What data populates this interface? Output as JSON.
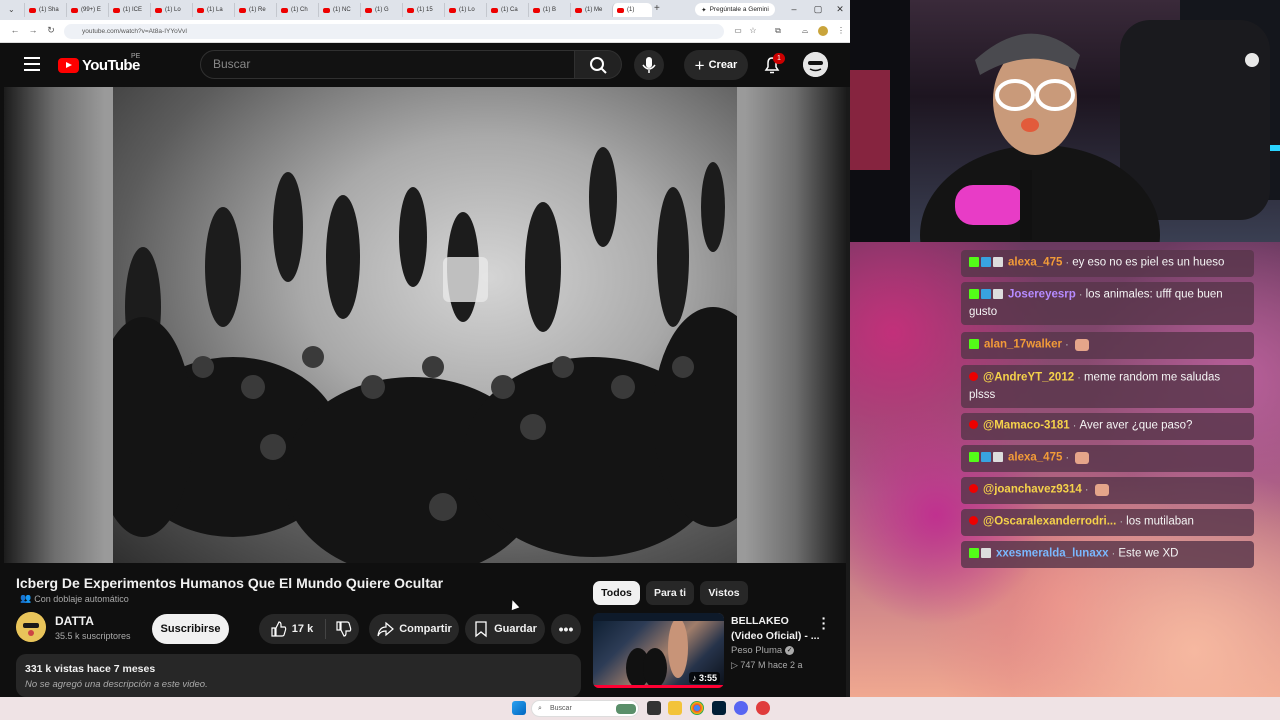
{
  "browser": {
    "tabs": [
      {
        "label": "(1) Sha"
      },
      {
        "label": "(99+) E"
      },
      {
        "label": "(1) ICE"
      },
      {
        "label": "(1) Lo"
      },
      {
        "label": "(1) La"
      },
      {
        "label": "(1) Re"
      },
      {
        "label": "(1) Ch"
      },
      {
        "label": "(1) NC"
      },
      {
        "label": "(1) G"
      },
      {
        "label": "(1) 15"
      },
      {
        "label": "(1) Lo"
      },
      {
        "label": "(1) Ca"
      },
      {
        "label": "(1) B"
      },
      {
        "label": "(1) Me"
      },
      {
        "label": "(1)"
      }
    ],
    "gemini_label": "Pregúntale a Gemini",
    "url": "youtube.com/watch?v=At8a-IYYoVvI"
  },
  "youtube": {
    "logo_text": "YouTube",
    "region": "PE",
    "search_placeholder": "Buscar",
    "create_label": "Crear",
    "notifications_count": "1",
    "video": {
      "title": "Icberg De Experimentos Humanos Que El Mundo Quiere Ocultar",
      "dub_label": "Con doblaje automático",
      "channel": "DATTA",
      "subscribers": "35.5 k suscriptores",
      "subscribe_label": "Suscribirse",
      "likes": "17 k",
      "share_label": "Compartir",
      "save_label": "Guardar",
      "stats": "331 k vistas  hace 7 meses",
      "description": "No se agregó una descripción a este video."
    },
    "chips": [
      {
        "label": "Todos",
        "active": true
      },
      {
        "label": "Para ti",
        "active": false
      },
      {
        "label": "Vistos",
        "active": false
      }
    ],
    "recommendation": {
      "title": "BELLAKEO (Video Oficial) - ...",
      "channel": "Peso Pluma",
      "meta": "747 M   hace 2 a",
      "duration": "3:55"
    }
  },
  "chat": {
    "messages": [
      {
        "user": "alexa_475",
        "color": "#f29b38",
        "badges": [
          "kick",
          "blue",
          "white"
        ],
        "text": "ey eso no es piel es un hueso"
      },
      {
        "user": "Josereyesrp",
        "color": "#b58bff",
        "badges": [
          "kick",
          "blue",
          "white"
        ],
        "text": "los animales: ufff que buen gusto"
      },
      {
        "user": "alan_17walker",
        "color": "#f29b38",
        "badges": [
          "kick"
        ],
        "text": ""
      },
      {
        "user": "@AndreYT_2012",
        "color": "#f5d24a",
        "badges": [
          "yt"
        ],
        "text": "meme random me saludas plsss"
      },
      {
        "user": "@Mamaco-3181",
        "color": "#f5d24a",
        "badges": [
          "yt"
        ],
        "text": "Aver aver ¿que paso?"
      },
      {
        "user": "alexa_475",
        "color": "#f29b38",
        "badges": [
          "kick",
          "blue",
          "white"
        ],
        "text": ""
      },
      {
        "user": "@joanchavez9314",
        "color": "#f5d24a",
        "badges": [
          "yt"
        ],
        "text": ""
      },
      {
        "user": "@Oscaralexanderrodri...",
        "color": "#f5d24a",
        "badges": [
          "yt"
        ],
        "text": "los mutilaban"
      },
      {
        "user": "xxesmeralda_lunaxx",
        "color": "#7ab8ff",
        "badges": [
          "kick",
          "white"
        ],
        "text": "Este we XD"
      }
    ]
  },
  "taskbar": {
    "search_placeholder": "Buscar"
  }
}
